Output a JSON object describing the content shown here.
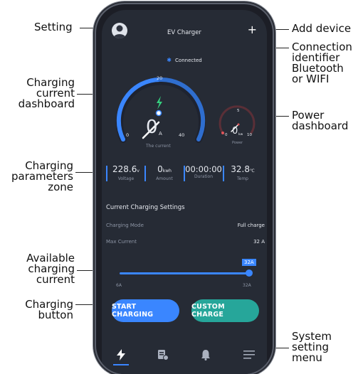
{
  "annotations": {
    "setting": "Setting",
    "add_device": "Add device",
    "connection": [
      "Connection",
      "identifier",
      "Bluetooth",
      "or WIFI"
    ],
    "charging_current_dashboard": [
      "Charging",
      "current",
      "dashboard"
    ],
    "power_dashboard": [
      "Power",
      "dashboard"
    ],
    "charging_parameters_zone": [
      "Charging",
      "parameters",
      "zone"
    ],
    "available_charging_current": [
      "Available",
      "charging",
      "current"
    ],
    "charging_button": [
      "Charging",
      "button"
    ],
    "system_setting_menu": [
      "System",
      "setting",
      "menu"
    ]
  },
  "app": {
    "title": "EV Charger",
    "status": "Connected",
    "current_gauge": {
      "value": "0",
      "unit": "A",
      "label": "The current",
      "ticks": {
        "min": "0",
        "mid": "20",
        "max": "40"
      },
      "min": 0,
      "max": 40,
      "current": 0
    },
    "power_gauge": {
      "value": "0",
      "unit": "kw",
      "label": "Power",
      "ticks": {
        "min": "0",
        "mid": "5",
        "max": "10"
      },
      "min": 0,
      "max": 10,
      "current": 0
    },
    "params": [
      {
        "value": "228.6",
        "unit": "v",
        "label": "Voltage"
      },
      {
        "value": "0",
        "unit": "kwh",
        "label": "Amount"
      },
      {
        "value": "00:00:00",
        "unit": "",
        "label": "Duration"
      },
      {
        "value": "32.8",
        "unit": "℃",
        "label": "Temp"
      }
    ],
    "settings": {
      "heading": "Current Charging Settings",
      "mode_label": "Charging Mode",
      "mode_value": "Full charge",
      "max_label": "Max Current",
      "max_value": "32 A"
    },
    "slider": {
      "badge": "32A",
      "min_label": "6A",
      "max_label": "32A",
      "min": 6,
      "max": 32,
      "value": 32
    },
    "buttons": {
      "start": "START CHARGING",
      "custom": "CUSTOM CHARGE"
    },
    "colors": {
      "accent": "#3a86ff",
      "teal": "#26a69a",
      "green": "#35d07f",
      "power_red": "#e0565b"
    }
  }
}
